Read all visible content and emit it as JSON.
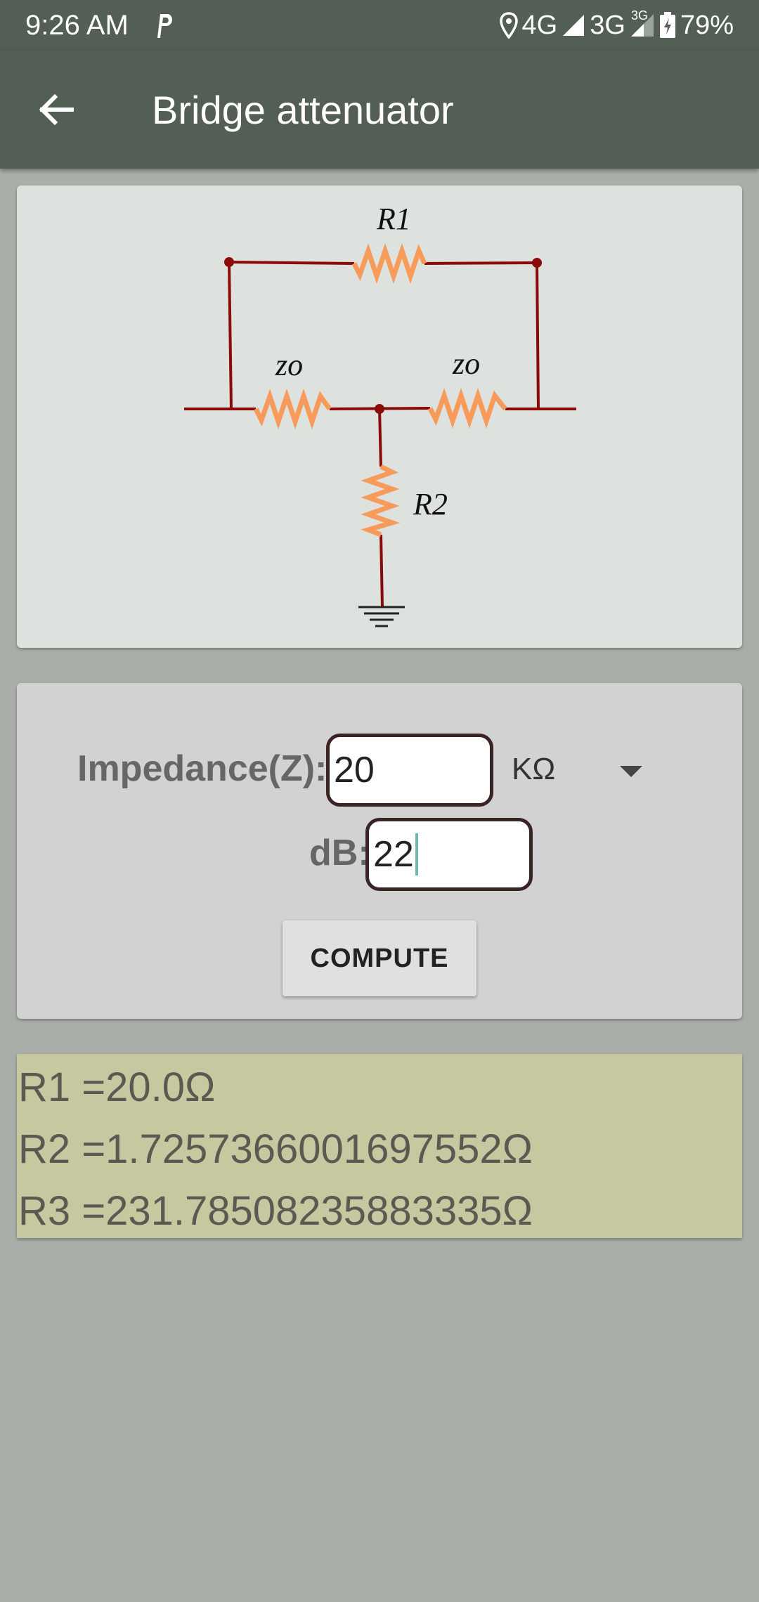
{
  "status_bar": {
    "time": "9:26 AM",
    "network_1": "4G",
    "network_2": "3G",
    "network_2_super": "3G",
    "battery": "79%"
  },
  "app_bar": {
    "title": "Bridge attenuator"
  },
  "diagram": {
    "label_r1": "R1",
    "label_zo_left": "zo",
    "label_zo_right": "zo",
    "label_r2": "R2"
  },
  "form": {
    "impedance_label": "Impedance(Z):",
    "impedance_value": "20",
    "unit": "KΩ",
    "db_label": "dB:",
    "db_value": "22",
    "compute_label": "COMPUTE"
  },
  "results": {
    "r1": "R1 =20.0Ω",
    "r2": "R2 =1.7257366001697552Ω",
    "r3": "R3 =231.78508235883335Ω"
  },
  "colors": {
    "bar": "#535e55",
    "background": "#a9aea9",
    "wire": "#8b0a0a",
    "resistor": "#f79a5a",
    "result_bg": "#c6c8a0"
  }
}
